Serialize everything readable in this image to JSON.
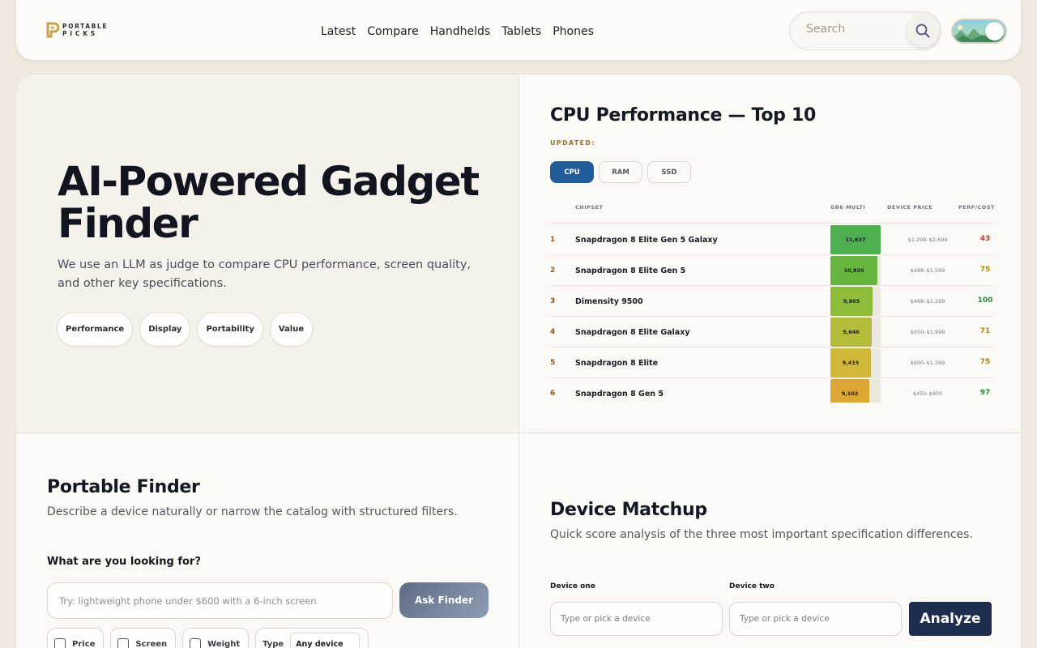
{
  "brand": {
    "line1": "PORTABLE",
    "line2": "PICKS"
  },
  "nav": [
    "Latest",
    "Compare",
    "Handhelds",
    "Tablets",
    "Phones"
  ],
  "search": {
    "placeholder": "Search"
  },
  "hero": {
    "title": "AI-Powered Gadget Finder",
    "subtitle": "We use an LLM as judge to compare CPU performance, screen quality, and other key specifications.",
    "chips": [
      "Performance",
      "Display",
      "Portability",
      "Value"
    ]
  },
  "cpu": {
    "title": "CPU Performance — Top 10",
    "updated_label": "UPDATED:",
    "tabs": [
      "CPU",
      "RAM",
      "SSD"
    ],
    "active_tab": 0,
    "columns": {
      "chipset": "CHIPSET",
      "score": "GB6 MULTI",
      "price": "DEVICE PRICE",
      "perf": "PERF/COST"
    },
    "score_max": 11637,
    "rows": [
      {
        "rank": "1",
        "name": "Snapdragon 8 Elite Gen 5 Galaxy",
        "score": "11,637",
        "score_value": 11637,
        "price": "$1,299–$2,699",
        "perf": "43",
        "bar_color": "#4caf50",
        "perf_color": "#c0392b"
      },
      {
        "rank": "2",
        "name": "Snapdragon 8 Elite Gen 5",
        "score": "10,835",
        "score_value": 10835,
        "price": "$688–$1,599",
        "perf": "75",
        "bar_color": "#66b53e",
        "perf_color": "#b8860b"
      },
      {
        "rank": "3",
        "name": "Dimensity 9500",
        "score": "9,805",
        "score_value": 9805,
        "price": "$468–$1,299",
        "perf": "100",
        "bar_color": "#8dbb3a",
        "perf_color": "#2e8b3e"
      },
      {
        "rank": "4",
        "name": "Snapdragon 8 Elite Galaxy",
        "score": "9,646",
        "score_value": 9646,
        "price": "$650–$1,999",
        "perf": "71",
        "bar_color": "#b5bc3c",
        "perf_color": "#b8860b"
      },
      {
        "rank": "5",
        "name": "Snapdragon 8 Elite",
        "score": "9,415",
        "score_value": 9415,
        "price": "$600–$1,599",
        "perf": "75",
        "bar_color": "#d2b83a",
        "perf_color": "#b8860b"
      },
      {
        "rank": "6",
        "name": "Snapdragon 8 Gen 5",
        "score": "9,102",
        "score_value": 9102,
        "price": "$450–$900",
        "perf": "97",
        "bar_color": "#dba634",
        "perf_color": "#2e8b3e"
      }
    ]
  },
  "finder": {
    "title": "Portable Finder",
    "subtitle": "Describe a device naturally or narrow the catalog with structured filters.",
    "question": "What are you looking for?",
    "input_placeholder": "Try: lightweight phone under $600 with a 6-inch screen",
    "button": "Ask Finder",
    "filters": [
      "Price",
      "Screen",
      "Weight"
    ],
    "type_label": "Type",
    "type_value": "Any device"
  },
  "matchup": {
    "title": "Device Matchup",
    "subtitle": "Quick score analysis of the three most important specification differences.",
    "device_one_label": "Device one",
    "device_two_label": "Device two",
    "device_placeholder": "Type or pick a device",
    "button": "Analyze"
  }
}
